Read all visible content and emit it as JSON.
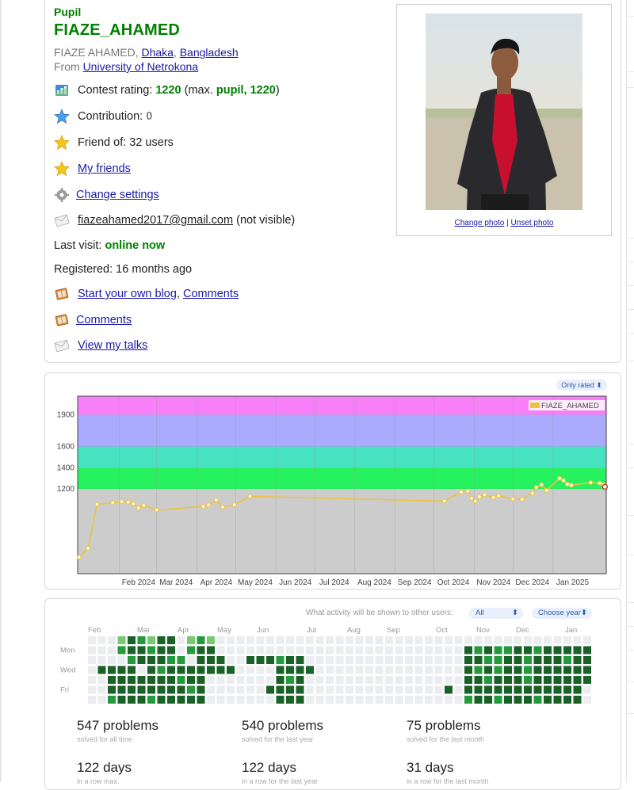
{
  "profile": {
    "rank": "Pupil",
    "handle": "FIAZE_AHAMED",
    "name": "FIAZE AHAMED",
    "city": "Dhaka",
    "country": "Bangladesh",
    "from_prefix": "From",
    "organization": "University of Netrokona",
    "contest_rating_label": "Contest rating:",
    "rating": "1220",
    "max_prefix": "(max.",
    "max_rank_rating": "pupil, 1220",
    "max_suffix": ")",
    "contribution_label": "Contribution:",
    "contribution": "0",
    "friend_of": "Friend of: 32 users",
    "my_friends": "My friends",
    "change_settings": "Change settings",
    "email": "fiazeahamed2017@gmail.com",
    "email_note": "(not visible)",
    "last_visit_label": "Last visit:",
    "last_visit": "online now",
    "registered": "Registered: 16 months ago",
    "start_blog": "Start your own blog",
    "comments": "Comments",
    "comments2": "Comments",
    "view_talks": "View my talks",
    "change_photo": "Change photo",
    "unset_photo": "Unset photo",
    "photo_sep": "|"
  },
  "rating_chart": {
    "filter_label": "Only rated ⬍"
  },
  "chart_data": {
    "type": "line",
    "series": [
      {
        "name": "FIAZE_AHAMED",
        "points": [
          [
            "2024-01-01",
            555
          ],
          [
            "2024-01-08",
            640
          ],
          [
            "2024-01-15",
            1055
          ],
          [
            "2024-01-27",
            1070
          ],
          [
            "2024-02-03",
            1080
          ],
          [
            "2024-02-08",
            1075
          ],
          [
            "2024-02-12",
            1060
          ],
          [
            "2024-02-16",
            1020
          ],
          [
            "2024-02-20",
            1045
          ],
          [
            "2024-03-01",
            1000
          ],
          [
            "2024-04-06",
            1035
          ],
          [
            "2024-04-10",
            1050
          ],
          [
            "2024-04-16",
            1095
          ],
          [
            "2024-04-21",
            1030
          ],
          [
            "2024-04-30",
            1050
          ],
          [
            "2024-05-12",
            1130
          ],
          [
            "2024-10-09",
            1085
          ],
          [
            "2024-10-22",
            1170
          ],
          [
            "2024-10-27",
            1180
          ],
          [
            "2024-10-30",
            1110
          ],
          [
            "2024-11-02",
            1085
          ],
          [
            "2024-11-05",
            1125
          ],
          [
            "2024-11-09",
            1145
          ],
          [
            "2024-11-16",
            1120
          ],
          [
            "2024-11-20",
            1135
          ],
          [
            "2024-12-01",
            1105
          ],
          [
            "2024-12-08",
            1100
          ],
          [
            "2024-12-16",
            1160
          ],
          [
            "2024-12-19",
            1215
          ],
          [
            "2024-12-23",
            1240
          ],
          [
            "2024-12-27",
            1185
          ],
          [
            "2025-01-06",
            1300
          ],
          [
            "2025-01-09",
            1280
          ],
          [
            "2025-01-12",
            1245
          ],
          [
            "2025-01-15",
            1235
          ],
          [
            "2025-01-30",
            1260
          ],
          [
            "2025-02-06",
            1255
          ],
          [
            "2025-02-09",
            1240
          ],
          [
            "2025-02-10",
            1220
          ]
        ]
      }
    ],
    "xlabels": [
      "Feb 2024",
      "Mar 2024",
      "Apr 2024",
      "May 2024",
      "Jun 2024",
      "Jul 2024",
      "Aug 2024",
      "Sep 2024",
      "Oct 2024",
      "Nov 2024",
      "Dec 2024",
      "Jan 2025"
    ],
    "yticks": [
      "1200",
      "1400",
      "1600",
      "1900"
    ],
    "xlim": [
      "2023-12-31",
      "2025-02-11"
    ],
    "ylim": [
      400,
      2075
    ],
    "bands": [
      {
        "from": 400,
        "to": 1200,
        "color": "#cccccc"
      },
      {
        "from": 1200,
        "to": 1400,
        "color": "#26f25f"
      },
      {
        "from": 1400,
        "to": 1600,
        "color": "#47e3c0"
      },
      {
        "from": 1600,
        "to": 1900,
        "color": "#aaaaff"
      },
      {
        "from": 1900,
        "to": 2075,
        "color": "#f77ff7"
      }
    ],
    "legend": "top-right",
    "grid": true
  },
  "activity": {
    "caption": "What activity will be shown to other users:",
    "visibility": "All",
    "year_select": "Choose year",
    "months": [
      "Feb",
      "Mar",
      "Apr",
      "May",
      "Jun",
      "Jul",
      "Aug",
      "Sep",
      "Oct",
      "Nov",
      "Dec",
      "Jan"
    ],
    "days": [
      "Mon",
      "Wed",
      "Fri"
    ],
    "heatmap": [
      [
        0,
        0,
        4,
        3,
        1,
        2,
        3,
        1,
        1,
        0,
        3,
        2,
        3,
        0,
        0,
        0,
        0,
        4,
        0,
        0,
        0,
        0,
        0,
        0,
        0,
        0,
        0,
        0,
        0,
        0,
        0,
        0,
        0,
        0,
        0,
        0,
        0,
        0,
        4,
        0,
        0,
        0,
        0,
        0,
        0,
        0,
        0,
        0,
        0,
        0,
        0
      ],
      [
        0,
        0,
        4,
        2,
        1,
        1,
        2,
        1,
        1,
        0,
        2,
        1,
        1,
        0,
        0,
        0,
        0,
        4,
        0,
        0,
        0,
        0,
        0,
        0,
        0,
        0,
        0,
        0,
        0,
        0,
        0,
        0,
        0,
        0,
        0,
        0,
        0,
        0,
        1,
        2,
        1,
        2,
        2,
        1,
        1,
        2,
        1,
        1,
        1,
        1,
        1
      ],
      [
        0,
        0,
        4,
        4,
        2,
        1,
        1,
        1,
        2,
        2,
        4,
        1,
        1,
        1,
        0,
        0,
        1,
        1,
        1,
        2,
        1,
        1,
        0,
        0,
        0,
        0,
        0,
        0,
        0,
        0,
        0,
        0,
        0,
        0,
        0,
        0,
        0,
        0,
        1,
        1,
        2,
        2,
        1,
        1,
        2,
        1,
        1,
        1,
        2,
        1,
        1
      ],
      [
        0,
        1,
        1,
        1,
        1,
        4,
        1,
        2,
        1,
        1,
        1,
        1,
        1,
        1,
        1,
        0,
        0,
        0,
        4,
        1,
        1,
        1,
        1,
        0,
        0,
        0,
        0,
        0,
        0,
        0,
        0,
        0,
        0,
        0,
        0,
        0,
        0,
        0,
        1,
        2,
        1,
        2,
        1,
        1,
        2,
        1,
        1,
        1,
        1,
        1,
        1
      ],
      [
        0,
        0,
        1,
        1,
        1,
        1,
        1,
        1,
        1,
        2,
        1,
        1,
        0,
        0,
        0,
        0,
        0,
        0,
        4,
        1,
        2,
        1,
        0,
        0,
        0,
        0,
        0,
        0,
        0,
        0,
        0,
        0,
        0,
        0,
        0,
        0,
        0,
        0,
        1,
        1,
        2,
        1,
        1,
        1,
        2,
        1,
        1,
        1,
        1,
        1,
        1
      ],
      [
        0,
        0,
        1,
        1,
        1,
        1,
        1,
        1,
        1,
        1,
        2,
        1,
        0,
        0,
        0,
        0,
        0,
        0,
        1,
        1,
        1,
        1,
        0,
        0,
        0,
        0,
        0,
        0,
        0,
        0,
        0,
        0,
        0,
        0,
        0,
        0,
        1,
        0,
        1,
        1,
        1,
        1,
        1,
        1,
        1,
        1,
        1,
        1,
        1,
        1,
        4
      ],
      [
        0,
        0,
        2,
        1,
        1,
        1,
        2,
        1,
        1,
        1,
        1,
        1,
        0,
        0,
        0,
        0,
        0,
        0,
        4,
        1,
        1,
        1,
        0,
        0,
        0,
        0,
        0,
        0,
        0,
        0,
        0,
        0,
        0,
        0,
        0,
        0,
        0,
        0,
        2,
        1,
        1,
        2,
        1,
        1,
        1,
        2,
        1,
        1,
        1,
        1,
        4
      ]
    ],
    "stats": [
      {
        "big": "547 problems",
        "small": "solved for all time"
      },
      {
        "big": "540 problems",
        "small": "solved for the last year"
      },
      {
        "big": "75 problems",
        "small": "solved for the last month"
      },
      {
        "big": "122 days",
        "small": "in a row max."
      },
      {
        "big": "122 days",
        "small": "in a row for the last year"
      },
      {
        "big": "31 days",
        "small": "in a row for the last month"
      }
    ],
    "colors": [
      "#ebedf0",
      "#196127",
      "#239a3b",
      "#7bc96f",
      "#ebedf0"
    ]
  }
}
